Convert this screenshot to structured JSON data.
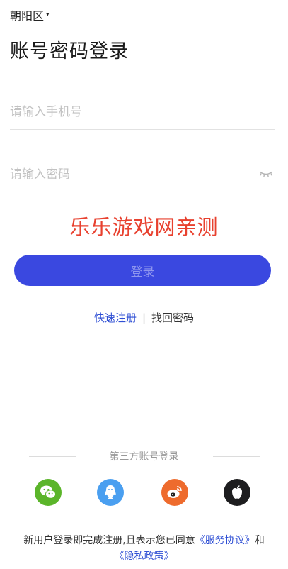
{
  "header": {
    "region": "朝阳区",
    "region_caret": "▾"
  },
  "title": "账号密码登录",
  "form": {
    "phone_placeholder": "请输入手机号",
    "phone_value": "",
    "password_placeholder": "请输入密码",
    "password_value": "",
    "eye_icon": "eye-closed-icon"
  },
  "watermark": "乐乐游戏网亲测",
  "login_button": "登录",
  "links": {
    "register": "快速注册",
    "separator": "|",
    "find_password": "找回密码"
  },
  "third_party": {
    "label": "第三方账号登录",
    "icons": [
      "wechat-icon",
      "qq-icon",
      "weibo-icon",
      "apple-icon"
    ]
  },
  "agreement": {
    "prefix": "新用户登录即完成注册,且表示您已同意",
    "service": "《服务协议》",
    "and": "和",
    "privacy": "《隐私政策》"
  },
  "colors": {
    "primary": "#3a48e0",
    "link": "#2f4fd4",
    "watermark": "#e8412f",
    "wechat": "#5bb52a",
    "qq": "#4a9ff0",
    "weibo": "#ee6b2d",
    "apple": "#1d1d1f"
  }
}
